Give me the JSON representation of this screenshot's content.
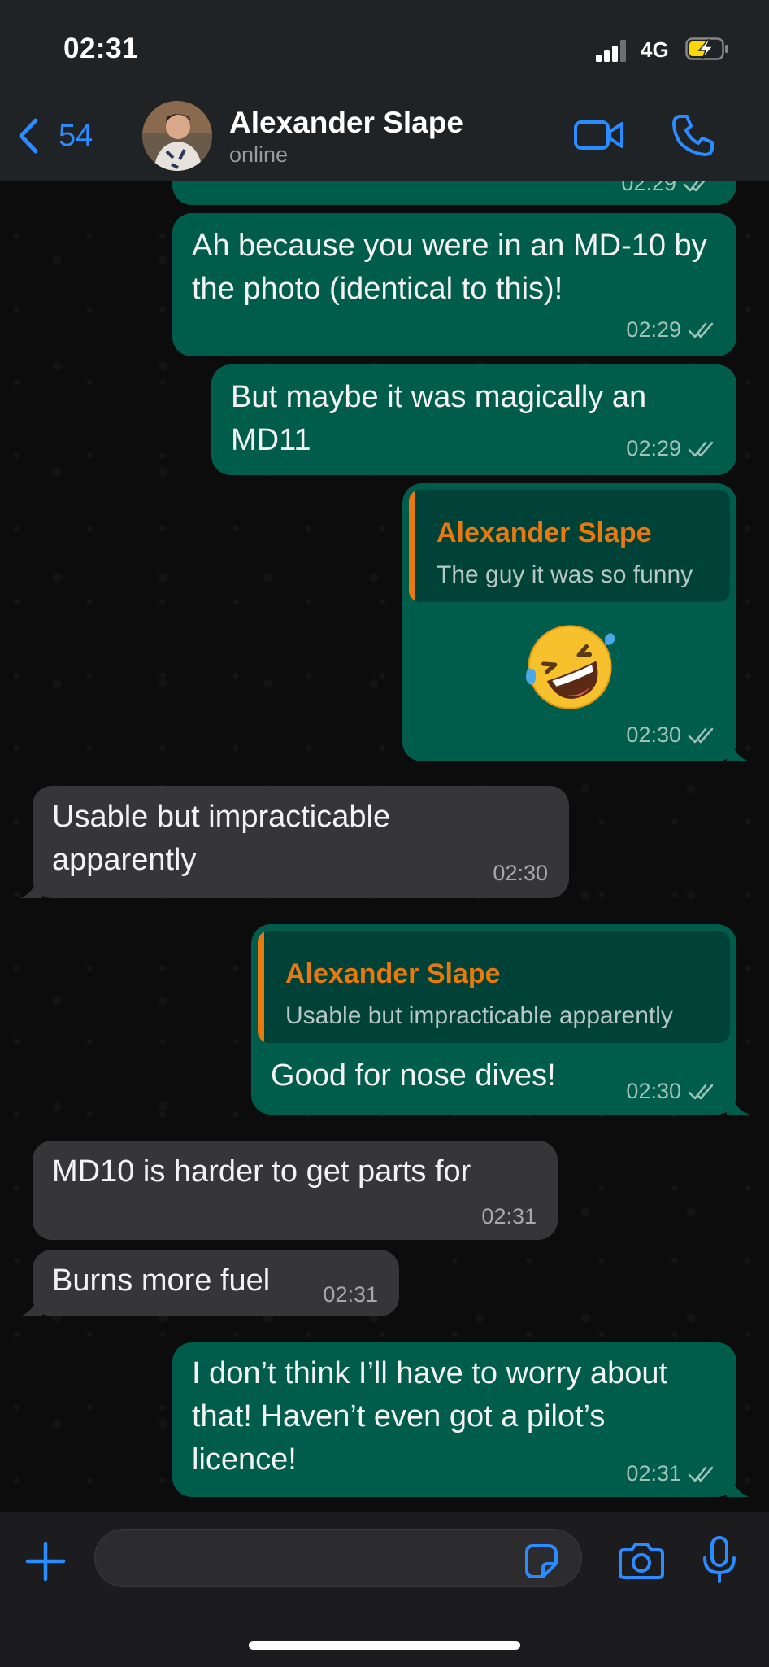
{
  "status_bar": {
    "time": "02:31",
    "network": "4G"
  },
  "header": {
    "back_count": "54",
    "contact_name": "Alexander Slape",
    "contact_status": "online"
  },
  "messages": [
    {
      "direction": "out",
      "text": "Ah because you were in an MD-10 by the photo (identical to this)!",
      "time": "02:29",
      "read": true
    },
    {
      "direction": "out",
      "text": "But maybe it was magically an MD11",
      "time": "02:29",
      "read": true
    },
    {
      "direction": "out",
      "quote": {
        "author": "Alexander Slape",
        "text": "The guy it was so funny"
      },
      "text": "🤣",
      "time": "02:30",
      "read": true
    },
    {
      "direction": "in",
      "text": "Usable but impracticable apparently",
      "time": "02:30"
    },
    {
      "direction": "out",
      "quote": {
        "author": "Alexander Slape",
        "text": "Usable but impracticable apparently"
      },
      "text": "Good for nose dives!",
      "time": "02:30",
      "read": true
    },
    {
      "direction": "in",
      "text": "MD10 is harder to get parts for",
      "time": "02:31"
    },
    {
      "direction": "in",
      "text": "Burns more fuel",
      "time": "02:31"
    },
    {
      "direction": "out",
      "text": "I don’t think I’ll have to worry about that! Haven’t even got a pilot’s licence!",
      "time": "02:31",
      "read": true
    }
  ],
  "top_partial_message": {
    "time": "02:29",
    "read": true
  },
  "input": {
    "placeholder": "",
    "value": ""
  },
  "colors": {
    "outgoing_bubble": "#005c4b",
    "incoming_bubble": "#363638",
    "accent_blue": "#2a8cff",
    "quote_author": "#e8790e"
  },
  "icons": [
    "back-chevron-icon",
    "video-call-icon",
    "phone-icon",
    "plus-icon",
    "sticker-icon",
    "camera-icon",
    "microphone-icon",
    "read-ticks-icon"
  ]
}
